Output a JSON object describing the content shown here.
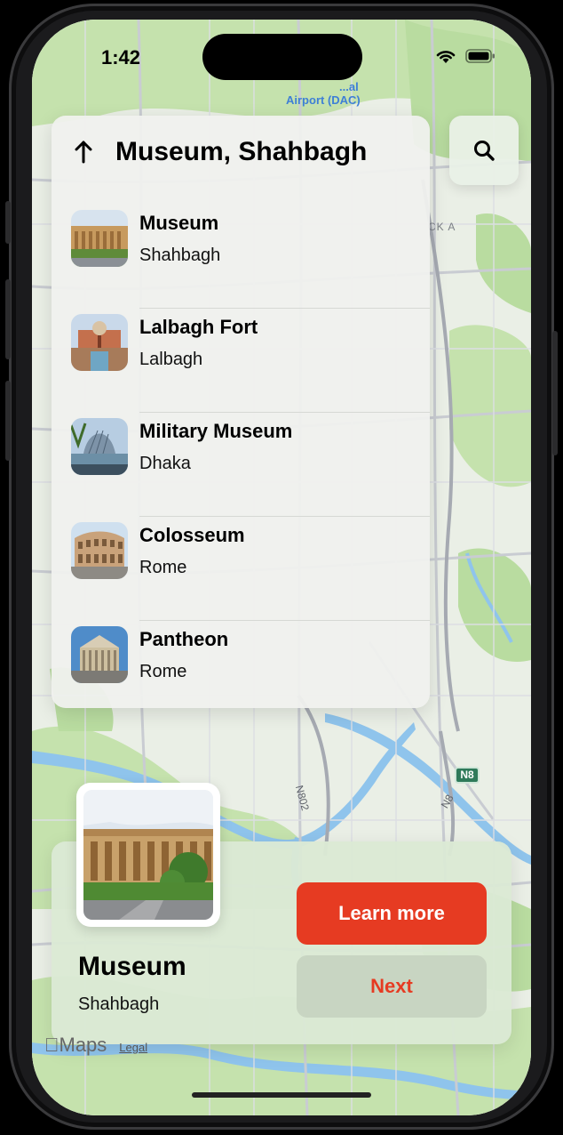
{
  "status_bar": {
    "time": "1:42",
    "wifi_icon": "wifi-icon",
    "battery_icon": "battery-icon"
  },
  "map": {
    "airport_label_line1": "...al",
    "airport_label_line2": "Airport (DAC)",
    "block_label": "CK A",
    "highway_badge": "N8",
    "road_label_1": "N802",
    "road_label_2": "N8",
    "attribution_logo": "Maps",
    "legal_link": "Legal"
  },
  "search_panel": {
    "back_icon": "arrow-up-icon",
    "title": "Museum, Shahbagh",
    "results": [
      {
        "title": "Museum",
        "subtitle": "Shahbagh",
        "thumb": "museum-photo"
      },
      {
        "title": "Lalbagh Fort",
        "subtitle": "Lalbagh",
        "thumb": "lalbagh-fort-photo"
      },
      {
        "title": "Military Museum",
        "subtitle": "Dhaka",
        "thumb": "military-museum-photo"
      },
      {
        "title": "Colosseum",
        "subtitle": "Rome",
        "thumb": "colosseum-photo"
      },
      {
        "title": "Pantheon",
        "subtitle": "Rome",
        "thumb": "pantheon-photo"
      }
    ]
  },
  "search_button": {
    "icon": "search-icon"
  },
  "detail_card": {
    "title": "Museum",
    "subtitle": "Shahbagh",
    "learn_more_label": "Learn more",
    "next_label": "Next"
  },
  "colors": {
    "accent": "#e63b22",
    "next_bg": "#c8d5c2",
    "card_bg": "#dbe9d4",
    "panel_bg": "#f0f1ee",
    "map_water": "#8fc4ec",
    "map_park": "#b9dca0"
  }
}
